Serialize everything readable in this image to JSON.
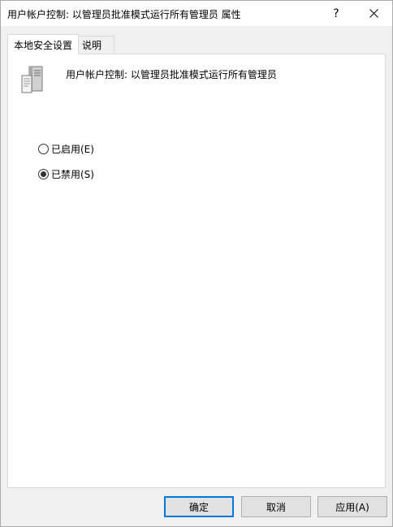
{
  "window": {
    "title": "用户帐户控制: 以管理员批准模式运行所有管理员 属性",
    "help_label": "?",
    "close_icon": "close-icon"
  },
  "tabs": [
    {
      "label": "本地安全设置",
      "active": true
    },
    {
      "label": "说明",
      "active": false
    }
  ],
  "panel": {
    "policy_icon": "server-policy-icon",
    "policy_name": "用户帐户控制: 以管理员批准模式运行所有管理员",
    "options": [
      {
        "label": "已启用(E)",
        "selected": false
      },
      {
        "label": "已禁用(S)",
        "selected": true
      }
    ]
  },
  "buttons": {
    "ok": "确定",
    "cancel": "取消",
    "apply": "应用(A)"
  },
  "colors": {
    "default_button_border": "#0078d7",
    "button_face": "#e1e1e1",
    "dialog_background": "#f0f0f0"
  }
}
